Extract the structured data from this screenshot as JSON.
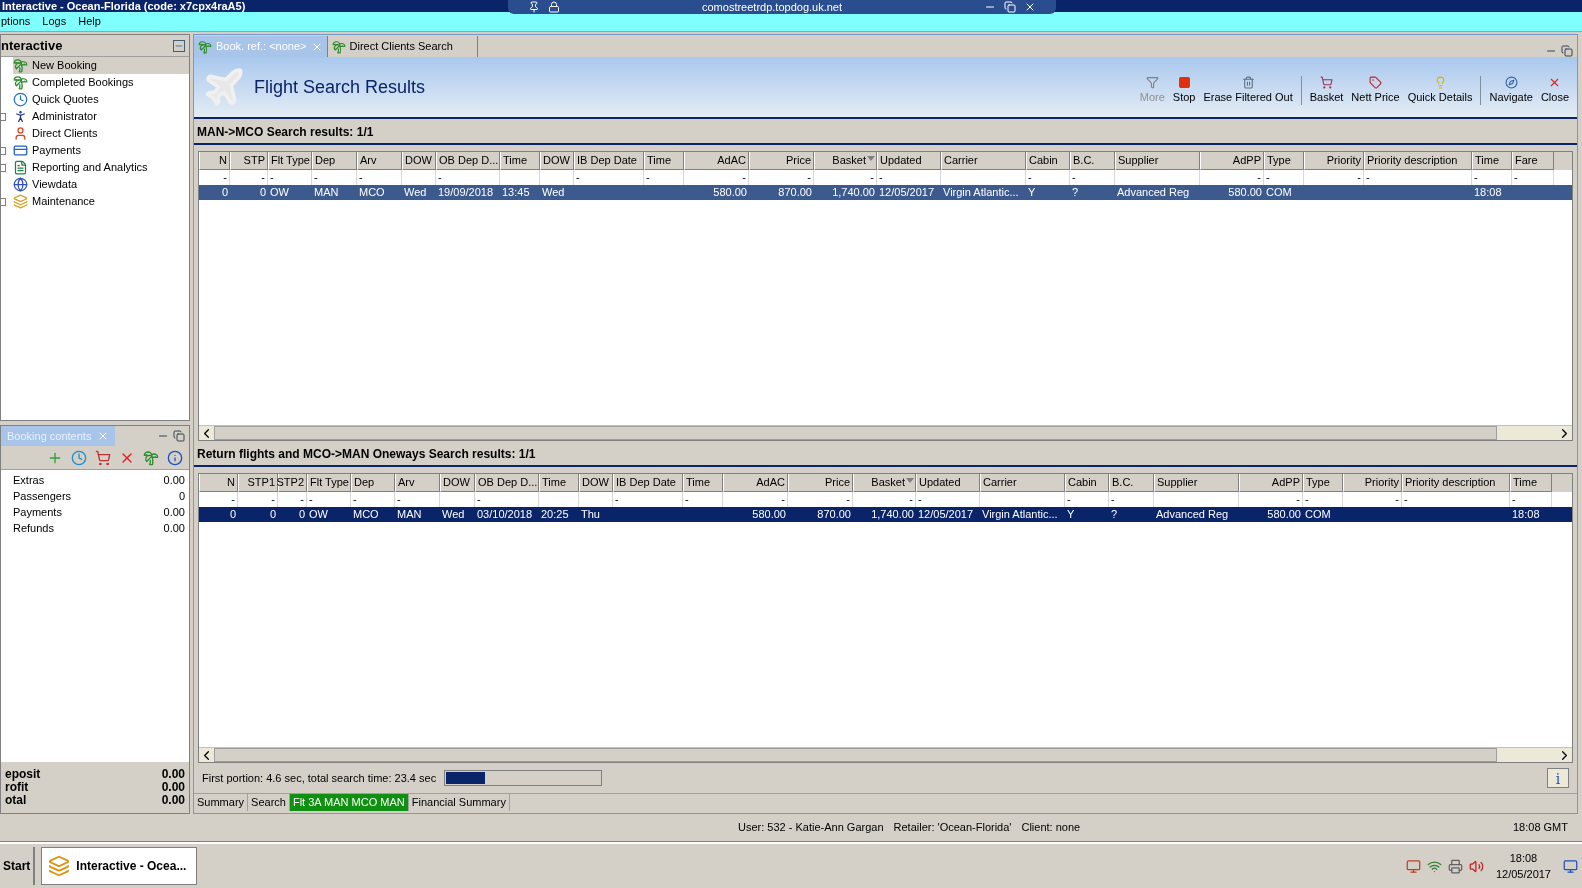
{
  "window": {
    "title": "Interactive - Ocean-Florida (code: x7cpx4raA5)"
  },
  "remote_bar": {
    "host": "comostreetrdp.topdog.uk.net"
  },
  "menu": [
    "ptions",
    "Logs",
    "Help"
  ],
  "sidebar": {
    "title": "nteractive",
    "items": [
      {
        "label": "New Booking",
        "selected": true,
        "expandable": false
      },
      {
        "label": "Completed Bookings",
        "selected": false,
        "expandable": false
      },
      {
        "label": "Quick Quotes",
        "selected": false,
        "expandable": false
      },
      {
        "label": "Administrator",
        "selected": false,
        "expandable": true
      },
      {
        "label": "Direct Clients",
        "selected": false,
        "expandable": false
      },
      {
        "label": "Payments",
        "selected": false,
        "expandable": true
      },
      {
        "label": "Reporting and Analytics",
        "selected": false,
        "expandable": true
      },
      {
        "label": "Viewdata",
        "selected": false,
        "expandable": false
      },
      {
        "label": "Maintenance",
        "selected": false,
        "expandable": true
      }
    ]
  },
  "booking_contents": {
    "tab": "Booking contents",
    "rows": [
      {
        "label": "Extras",
        "value": "0.00"
      },
      {
        "label": "Passengers",
        "value": "0"
      },
      {
        "label": "Payments",
        "value": "0.00"
      },
      {
        "label": "Refunds",
        "value": "0.00"
      }
    ],
    "totals": [
      {
        "label": "eposit",
        "value": "0.00"
      },
      {
        "label": "rofit",
        "value": "0.00"
      },
      {
        "label": "otal",
        "value": "0.00"
      }
    ]
  },
  "doc_tabs": [
    {
      "label": "Book. ref.: <none>",
      "selected": true,
      "closable": true
    },
    {
      "label": "Direct Clients Search",
      "selected": false,
      "closable": false
    }
  ],
  "header": {
    "title": "Flight Search Results"
  },
  "toolbar": [
    {
      "label": "More",
      "disabled": true,
      "separator_before": false
    },
    {
      "label": "Stop",
      "disabled": false,
      "separator_before": false
    },
    {
      "label": "Erase Filtered Out",
      "disabled": false,
      "separator_before": false
    },
    {
      "label": "Basket",
      "disabled": false,
      "separator_before": true
    },
    {
      "label": "Nett Price",
      "disabled": false,
      "separator_before": false
    },
    {
      "label": "Quick Details",
      "disabled": false,
      "separator_before": false
    },
    {
      "label": "Navigate",
      "disabled": false,
      "separator_before": true
    },
    {
      "label": "Close",
      "disabled": false,
      "separator_before": false
    }
  ],
  "outbound": {
    "heading": "MAN->MCO Search results: 1/1",
    "focused": false,
    "columns": [
      {
        "label": "N",
        "numeric": true,
        "sorted": false,
        "filter": "-"
      },
      {
        "label": "STP",
        "numeric": true,
        "sorted": false,
        "filter": "-"
      },
      {
        "label": "Flt Type",
        "numeric": false,
        "sorted": false,
        "filter": "-"
      },
      {
        "label": "Dep",
        "numeric": false,
        "sorted": false,
        "filter": "-"
      },
      {
        "label": "Arv",
        "numeric": false,
        "sorted": false,
        "filter": "-"
      },
      {
        "label": "DOW",
        "numeric": false,
        "sorted": false
      },
      {
        "label": "OB Dep D...",
        "numeric": false,
        "sorted": false,
        "filter": "-"
      },
      {
        "label": "Time",
        "numeric": false,
        "sorted": false
      },
      {
        "label": "DOW",
        "numeric": false,
        "sorted": false
      },
      {
        "label": "IB Dep Date",
        "numeric": false,
        "sorted": false,
        "filter": "-"
      },
      {
        "label": "Time",
        "numeric": false,
        "sorted": false,
        "filter": "-"
      },
      {
        "label": "AdAC",
        "numeric": true,
        "sorted": false,
        "filter": "-"
      },
      {
        "label": "Price",
        "numeric": true,
        "sorted": false,
        "filter": "-"
      },
      {
        "label": "Basket",
        "numeric": true,
        "sorted": true,
        "filter": "-"
      },
      {
        "label": "Updated",
        "numeric": false,
        "sorted": false,
        "filter": "-"
      },
      {
        "label": "Carrier",
        "numeric": false,
        "sorted": false
      },
      {
        "label": "Cabin",
        "numeric": false,
        "sorted": false,
        "filter": "-"
      },
      {
        "label": "B.C.",
        "numeric": false,
        "sorted": false,
        "filter": "-"
      },
      {
        "label": "Supplier",
        "numeric": false,
        "sorted": false
      },
      {
        "label": "AdPP",
        "numeric": true,
        "sorted": false,
        "filter": "-"
      },
      {
        "label": "Type",
        "numeric": false,
        "sorted": false,
        "filter": "-"
      },
      {
        "label": "Priority",
        "numeric": true,
        "sorted": false,
        "filter": "-"
      },
      {
        "label": "Priority description",
        "numeric": false,
        "sorted": false,
        "filter": "-"
      },
      {
        "label": "Time",
        "numeric": false,
        "sorted": false,
        "filter": "-"
      },
      {
        "label": "Fare",
        "numeric": false,
        "sorted": false,
        "filter": "-"
      }
    ],
    "rows": [
      {
        "selected": true,
        "cells": [
          "0",
          "0",
          "OW",
          "MAN",
          "MCO",
          "Wed",
          "19/09/2018",
          "13:45",
          "Wed",
          null,
          null,
          "580.00",
          "870.00",
          "1,740.00",
          "12/05/2017",
          "Virgin Atlantic...",
          "Y",
          "?",
          "Advanced Reg",
          "580.00",
          "COM",
          null,
          null,
          "18:08",
          null
        ]
      }
    ]
  },
  "return": {
    "heading": "Return flights and MCO->MAN Oneways Search results: 1/1",
    "focused": true,
    "columns": [
      {
        "label": "N",
        "numeric": true,
        "sorted": false,
        "filter": "-"
      },
      {
        "label": "STP1",
        "numeric": true,
        "sorted": false,
        "filter": "-"
      },
      {
        "label": "STP2",
        "numeric": true,
        "sorted": false,
        "filter": "-"
      },
      {
        "label": "Flt Type",
        "numeric": false,
        "sorted": false,
        "filter": "-"
      },
      {
        "label": "Dep",
        "numeric": false,
        "sorted": false,
        "filter": "-"
      },
      {
        "label": "Arv",
        "numeric": false,
        "sorted": false,
        "filter": "-"
      },
      {
        "label": "DOW",
        "numeric": false,
        "sorted": false
      },
      {
        "label": "OB Dep D...",
        "numeric": false,
        "sorted": false,
        "filter": "-"
      },
      {
        "label": "Time",
        "numeric": false,
        "sorted": false
      },
      {
        "label": "DOW",
        "numeric": false,
        "sorted": false
      },
      {
        "label": "IB Dep Date",
        "numeric": false,
        "sorted": false,
        "filter": "-"
      },
      {
        "label": "Time",
        "numeric": false,
        "sorted": false,
        "filter": "-"
      },
      {
        "label": "AdAC",
        "numeric": true,
        "sorted": false,
        "filter": "-"
      },
      {
        "label": "Price",
        "numeric": true,
        "sorted": false,
        "filter": "-"
      },
      {
        "label": "Basket",
        "numeric": true,
        "sorted": true,
        "filter": "-"
      },
      {
        "label": "Updated",
        "numeric": false,
        "sorted": false,
        "filter": "-"
      },
      {
        "label": "Carrier",
        "numeric": false,
        "sorted": false
      },
      {
        "label": "Cabin",
        "numeric": false,
        "sorted": false,
        "filter": "-"
      },
      {
        "label": "B.C.",
        "numeric": false,
        "sorted": false,
        "filter": "-"
      },
      {
        "label": "Supplier",
        "numeric": false,
        "sorted": false
      },
      {
        "label": "AdPP",
        "numeric": true,
        "sorted": false,
        "filter": "-"
      },
      {
        "label": "Type",
        "numeric": false,
        "sorted": false,
        "filter": "-"
      },
      {
        "label": "Priority",
        "numeric": true,
        "sorted": false,
        "filter": "-"
      },
      {
        "label": "Priority description",
        "numeric": false,
        "sorted": false,
        "filter": "-"
      },
      {
        "label": "Time",
        "numeric": false,
        "sorted": false,
        "filter": "-"
      }
    ],
    "rows": [
      {
        "selected": true,
        "cells": [
          "0",
          "0",
          "0",
          "OW",
          "MCO",
          "MAN",
          "Wed",
          "03/10/2018",
          "20:25",
          "Thu",
          null,
          null,
          "580.00",
          "870.00",
          "1,740.00",
          "12/05/2017",
          "Virgin Atlantic...",
          "Y",
          "?",
          "Advanced Reg",
          "580.00",
          "COM",
          null,
          null,
          "18:08"
        ]
      }
    ]
  },
  "progress": {
    "text": "First portion: 4.6 sec, total search time: 23.4 sec",
    "level": 0.25
  },
  "info_button": "i",
  "bottom_tabs": [
    {
      "label": "Summary",
      "selected": false
    },
    {
      "label": "Search",
      "selected": false
    },
    {
      "label": "Flt 3A MAN MCO MAN",
      "selected": true
    },
    {
      "label": "Financial Summary",
      "selected": false
    }
  ],
  "status_bar": {
    "user": "User: 532 - Katie-Ann Gargan",
    "retailer": "Retailer: 'Ocean-Florida'",
    "client": "Client: none",
    "time": "18:08 GMT"
  },
  "taskbar": {
    "start": "Start",
    "task": "Interactive - Ocea...",
    "clock_time": "18:08",
    "clock_date": "12/05/2017"
  }
}
